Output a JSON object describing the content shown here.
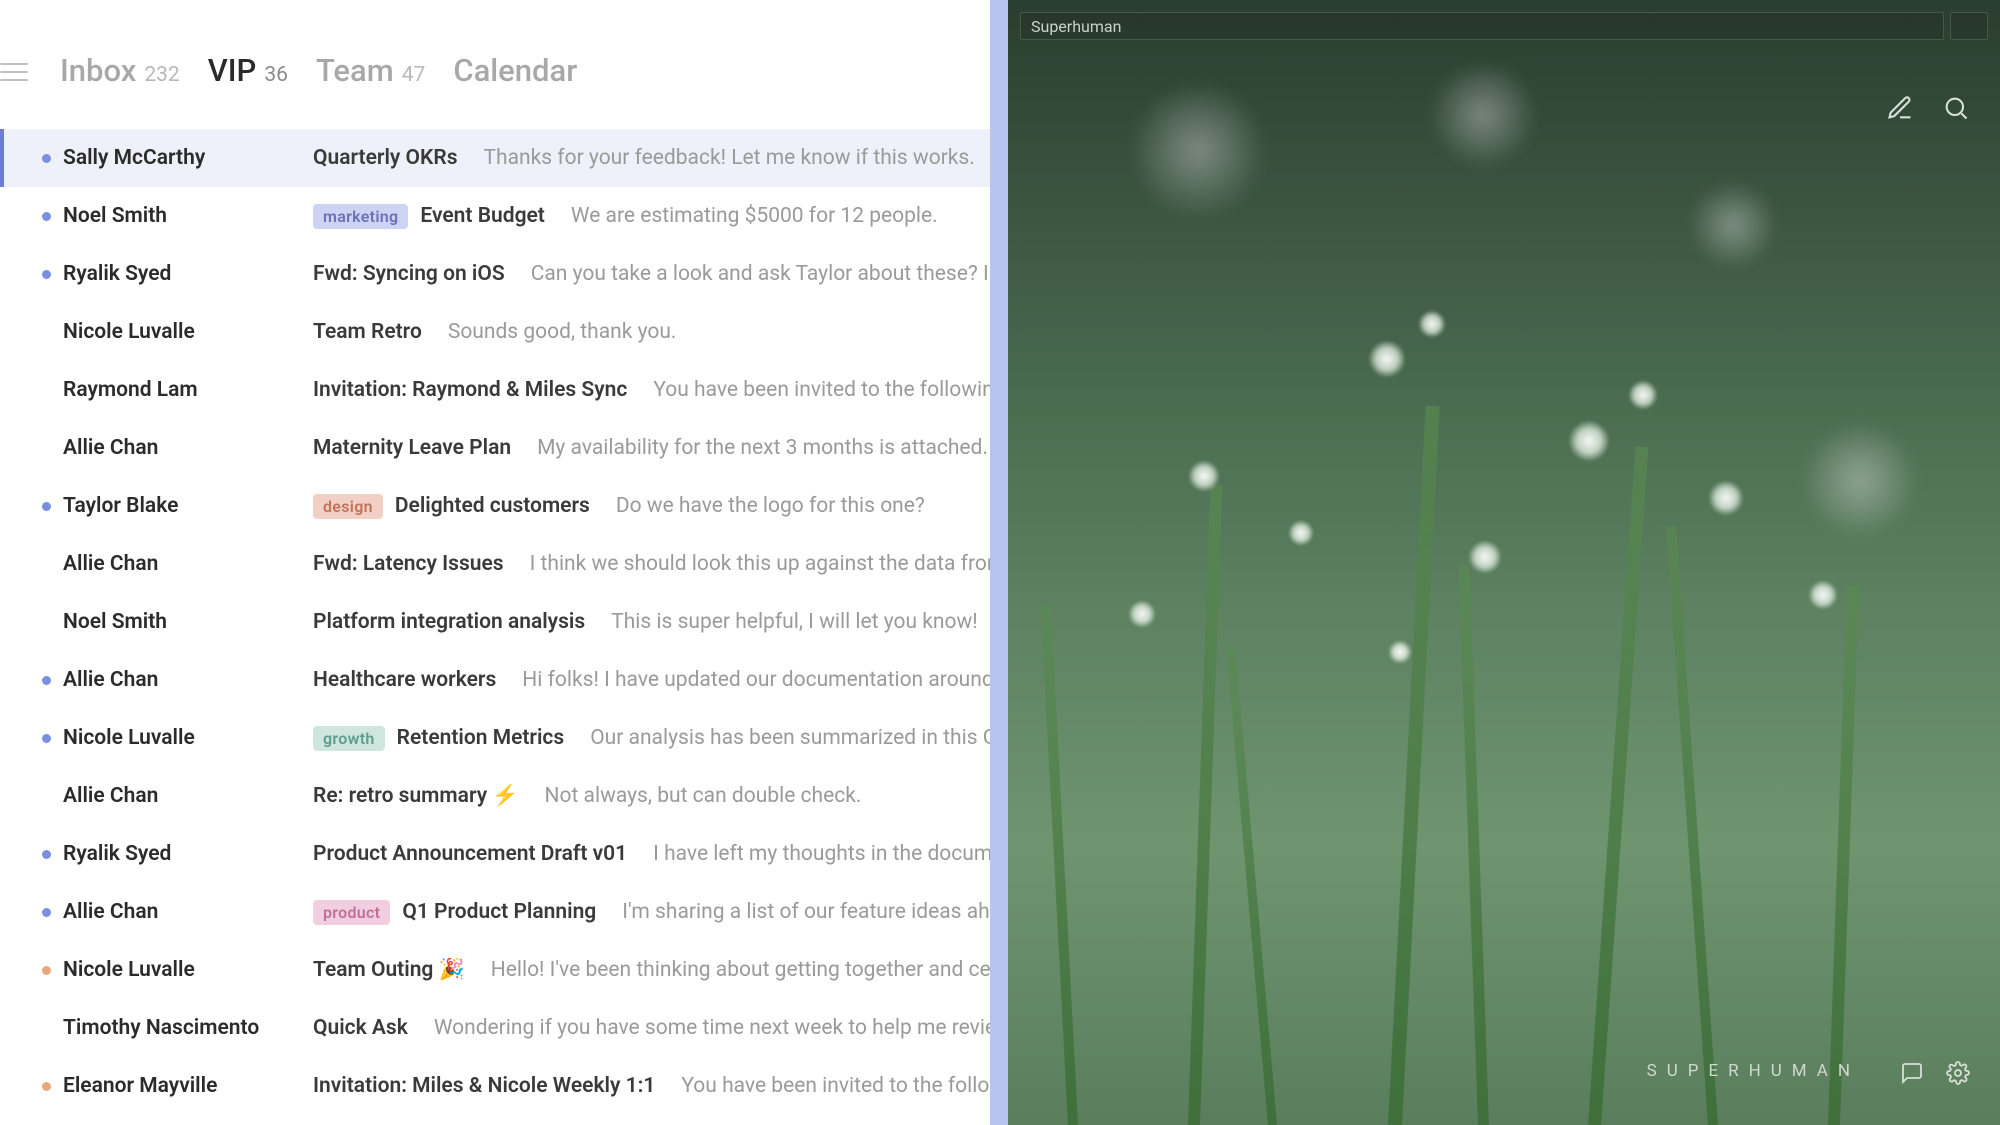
{
  "titlebar": {
    "app_name": "Superhuman"
  },
  "tabs": [
    {
      "label": "Inbox",
      "count": "232",
      "active": false
    },
    {
      "label": "VIP",
      "count": "36",
      "active": true
    },
    {
      "label": "Team",
      "count": "47",
      "active": false
    },
    {
      "label": "Calendar",
      "count": "",
      "active": false
    }
  ],
  "label_styles": {
    "marketing": {
      "bg": "#cdd3f2",
      "fg": "#6a72b8"
    },
    "design": {
      "bg": "#f2d0c6",
      "fg": "#c27458"
    },
    "growth": {
      "bg": "#cfe6df",
      "fg": "#5f9e8b"
    },
    "product": {
      "bg": "#f2cfe0",
      "fg": "#c06f9a"
    }
  },
  "emails": [
    {
      "sender": "Sally McCarthy",
      "subject": "Quarterly OKRs",
      "preview": "Thanks for your feedback! Let me know if this works.",
      "dot": "#7a8fe0",
      "selected": true,
      "label": null
    },
    {
      "sender": "Noel Smith",
      "subject": "Event Budget",
      "preview": "We are estimating $5000 for 12 people.",
      "dot": "#7a8fe0",
      "selected": false,
      "label": "marketing"
    },
    {
      "sender": "Ryalik Syed",
      "subject": "Fwd: Syncing on iOS",
      "preview": "Can you take a look and ask Taylor about these? I ha",
      "dot": "#7a8fe0",
      "selected": false,
      "label": null
    },
    {
      "sender": "Nicole Luvalle",
      "subject": "Team Retro",
      "preview": "Sounds good, thank you.",
      "dot": "",
      "selected": false,
      "label": null
    },
    {
      "sender": "Raymond Lam",
      "subject": "Invitation: Raymond & Miles Sync",
      "preview": "You have been invited to the following",
      "dot": "",
      "selected": false,
      "label": null
    },
    {
      "sender": "Allie Chan",
      "subject": "Maternity Leave Plan",
      "preview": "My availability for the next 3 months is attached.",
      "dot": "",
      "selected": false,
      "label": null
    },
    {
      "sender": "Taylor Blake",
      "subject": "Delighted customers",
      "preview": "Do we have the logo for this one?",
      "dot": "#7a8fe0",
      "selected": false,
      "label": "design"
    },
    {
      "sender": "Allie Chan",
      "subject": "Fwd: Latency Issues",
      "preview": "I think we should look this up against the data from",
      "dot": "",
      "selected": false,
      "label": null
    },
    {
      "sender": "Noel Smith",
      "subject": "Platform integration analysis",
      "preview": "This is super helpful, I will let you know!",
      "dot": "",
      "selected": false,
      "label": null
    },
    {
      "sender": "Allie Chan",
      "subject": "Healthcare workers",
      "preview": "Hi folks! I have updated our documentation around p",
      "dot": "#7a8fe0",
      "selected": false,
      "label": null
    },
    {
      "sender": "Nicole Luvalle",
      "subject": "Retention Metrics",
      "preview": "Our analysis has been summarized in this G",
      "dot": "#7a8fe0",
      "selected": false,
      "label": "growth"
    },
    {
      "sender": "Allie Chan",
      "subject": "Re: retro summary ⚡",
      "preview": "Not always, but can double check.",
      "dot": "",
      "selected": false,
      "label": null
    },
    {
      "sender": "Ryalik Syed",
      "subject": "Product Announcement Draft v01",
      "preview": "I have left my thoughts in the docume",
      "dot": "#7a8fe0",
      "selected": false,
      "label": null
    },
    {
      "sender": "Allie Chan",
      "subject": "Q1 Product Planning",
      "preview": "I'm sharing a list of our feature ideas ahea",
      "dot": "#7a8fe0",
      "selected": false,
      "label": "product"
    },
    {
      "sender": "Nicole Luvalle",
      "subject": "Team Outing 🎉",
      "preview": "Hello! I've been thinking about getting together and cele",
      "dot": "#e8a87c",
      "selected": false,
      "label": null
    },
    {
      "sender": "Timothy Nascimento",
      "subject": "Quick Ask",
      "preview": "Wondering if you have some time next week to help me review",
      "dot": "",
      "selected": false,
      "label": null
    },
    {
      "sender": "Eleanor Mayville",
      "subject": "Invitation: Miles & Nicole Weekly 1:1",
      "preview": "You have been invited to the followin",
      "dot": "#e8a87c",
      "selected": false,
      "label": null
    }
  ],
  "brand_text": "SUPERHUMAN"
}
